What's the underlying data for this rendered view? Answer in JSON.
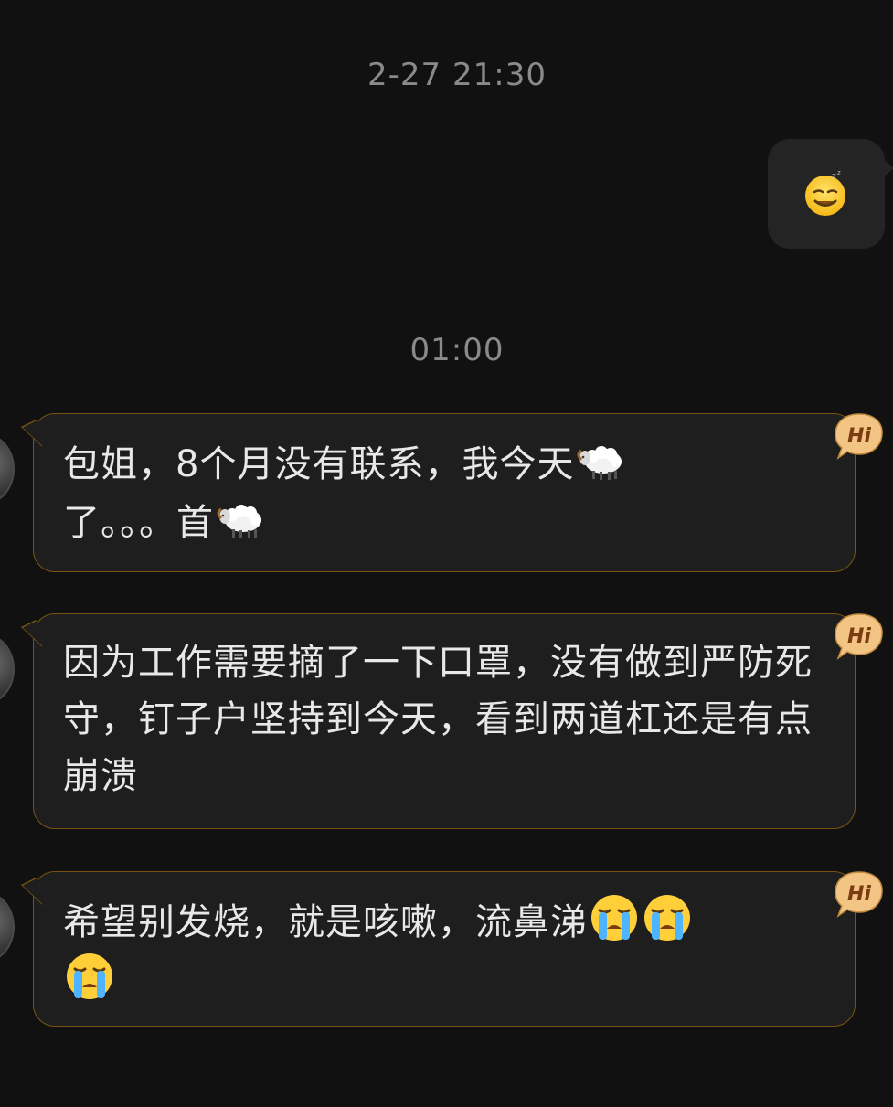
{
  "timestamps": {
    "first": "2-27 21:30",
    "second": "01:00"
  },
  "sent_message": {
    "emoji": "sleepy-face-emoji"
  },
  "received_messages": [
    {
      "parts": [
        "包姐，8个月没有联系，我今天",
        "了。。。首"
      ],
      "emojis": [
        "sheep-emoji",
        "sheep-emoji"
      ]
    },
    {
      "text": "因为工作需要摘了一下口罩，没有做到严防死守，钉子户坚持到今天，看到两道杠还是有点崩溃"
    },
    {
      "text": "希望别发烧，就是咳嗽，流鼻涕",
      "emojis": [
        "crying-face-emoji",
        "crying-face-emoji",
        "crying-face-emoji"
      ]
    }
  ],
  "badge": {
    "label": "Hi"
  },
  "colors": {
    "background": "#111111",
    "bubble": "#1e1e1e",
    "bubble_border": "#7a5412",
    "badge": "#f3c585",
    "timestamp": "#8a8a8a"
  }
}
